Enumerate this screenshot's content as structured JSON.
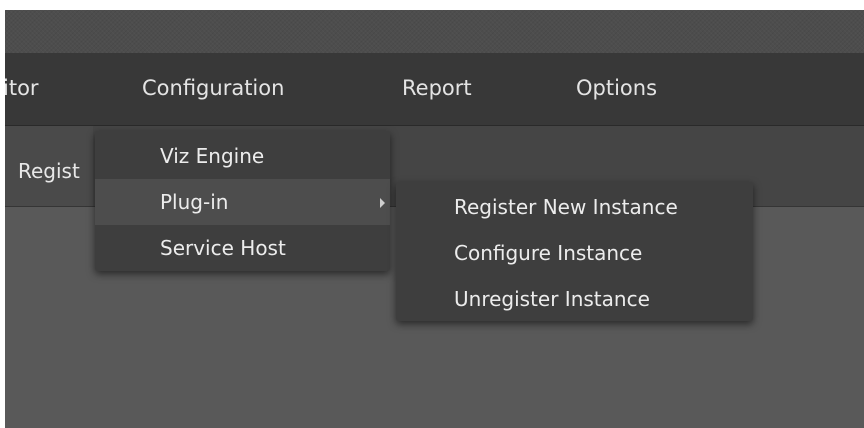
{
  "menubar": {
    "items": [
      {
        "label": "itor"
      },
      {
        "label": "Configuration"
      },
      {
        "label": "Report"
      },
      {
        "label": "Options"
      }
    ]
  },
  "toolbar": {
    "tab_label": "Regist"
  },
  "configuration_menu": {
    "items": [
      {
        "label": "Viz Engine"
      },
      {
        "label": "Plug-in"
      },
      {
        "label": "Service Host"
      }
    ]
  },
  "plugin_submenu": {
    "items": [
      {
        "label": "Register New Instance"
      },
      {
        "label": "Configure Instance"
      },
      {
        "label": "Unregister Instance"
      }
    ]
  },
  "colors": {
    "menubar_bg": "#383838",
    "dropdown_bg": "#3e3e3e",
    "hover_bg": "#4d4d4d",
    "text": "#ececec"
  }
}
